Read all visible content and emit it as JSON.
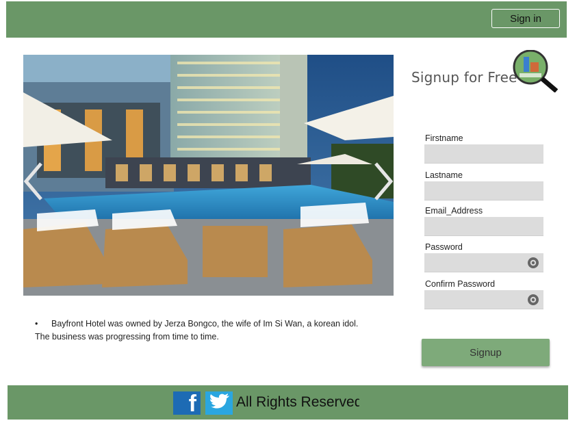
{
  "header": {
    "signin_label": "Sign in"
  },
  "carousel": {
    "prev_icon": "chevron-left-icon",
    "next_icon": "chevron-right-icon"
  },
  "caption": {
    "bullet": "•",
    "line1": "Bayfront Hotel was owned by Jerza Bongco, the wife of Im Si Wan, a korean idol.",
    "line2": "The business was progressing from time to time."
  },
  "signup": {
    "title": "Signup for Free",
    "fields": [
      {
        "label": "Firstname",
        "value": ""
      },
      {
        "label": "Lastname",
        "value": ""
      },
      {
        "label": "Email_Address",
        "value": ""
      },
      {
        "label": "Password",
        "value": "",
        "icon": "eye-icon"
      },
      {
        "label": "Confirm Password",
        "value": "",
        "icon": "eye-icon"
      }
    ],
    "button_label": "Signup"
  },
  "footer": {
    "facebook_glyph": "f",
    "rights": "All Rights Reserved"
  },
  "colors": {
    "header_bg": "#6a9767",
    "button_bg": "#7eaa7a",
    "input_bg": "#dcdcdc"
  }
}
